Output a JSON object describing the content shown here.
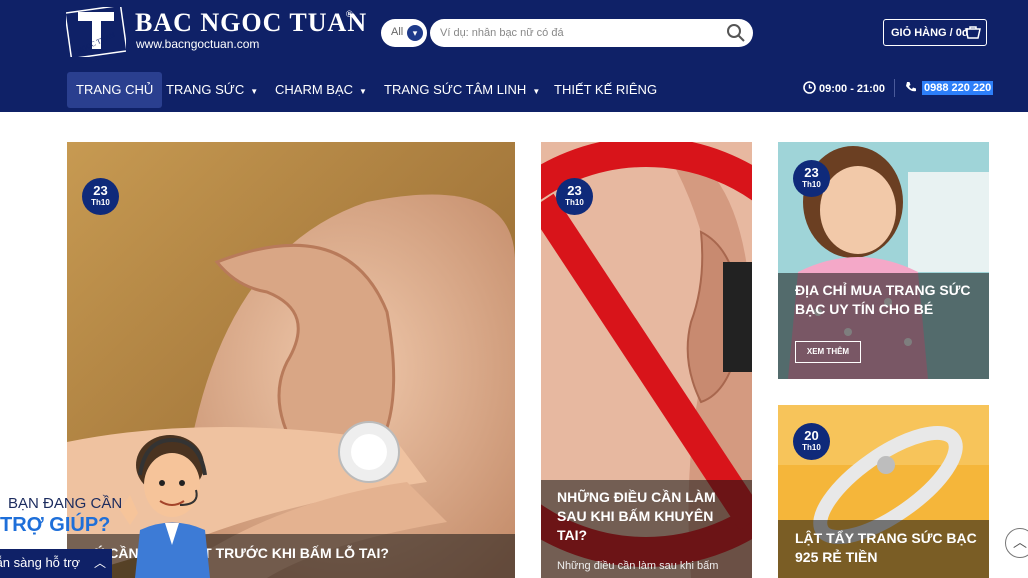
{
  "header": {
    "logo_name": "BAC NGOC TUAN",
    "logo_url": "www.bacngoctuan.com",
    "logo_registered": "®",
    "logo_mark_text": "NGOC TUAN",
    "search": {
      "category": "All",
      "placeholder": "Ví dụ: nhẫn bạc nữ có đá",
      "value": ""
    },
    "cart_label": "GIỎ HÀNG / 0đ",
    "hours": "09:00 - 21:00",
    "phone": "0988 220 220"
  },
  "nav": {
    "items": [
      {
        "label": "TRANG CHỦ",
        "active": true,
        "dropdown": false
      },
      {
        "label": "TRANG SỨC",
        "active": false,
        "dropdown": true
      },
      {
        "label": "CHARM BẠC",
        "active": false,
        "dropdown": true
      },
      {
        "label": "TRANG SỨC TÂM LINH",
        "active": false,
        "dropdown": true
      },
      {
        "label": "THIẾT KẾ RIÊNG",
        "active": false,
        "dropdown": false
      }
    ]
  },
  "posts": [
    {
      "day": "23",
      "month": "Th10",
      "title": "LƯU Ý CẦN PHẢI BIẾT TRƯỚC KHI BẤM LỖ TAI?",
      "title_visible": "Ý CẦN PHẢI BIẾT TRƯỚC KHI BẤM LỖ TAI?"
    },
    {
      "day": "23",
      "month": "Th10",
      "title": "NHỮNG ĐIỀU CẦN LÀM SAU KHI BẤM KHUYÊN TAI?",
      "excerpt": "Những điều cần làm sau khi bấm"
    },
    {
      "day": "23",
      "month": "Th10",
      "title": "ĐỊA CHỈ MUA TRANG SỨC BẠC UY TÍN CHO BÉ",
      "button": "XEM THÊM"
    },
    {
      "day": "20",
      "month": "Th10",
      "title": "LẬT TẨY TRANG SỨC BẠC 925 RẺ TIỀN"
    }
  ],
  "help": {
    "line1": "BẠN ĐANG CẦN",
    "line2": "TRỢ GIÚP?",
    "support_label": "Sẵn sàng hỗ trợ"
  },
  "colors": {
    "header_bg": "#0f2167",
    "nav_active": "#2a3f8f",
    "date_badge": "#0f2a7a",
    "phone_highlight": "#2d7ff9"
  }
}
